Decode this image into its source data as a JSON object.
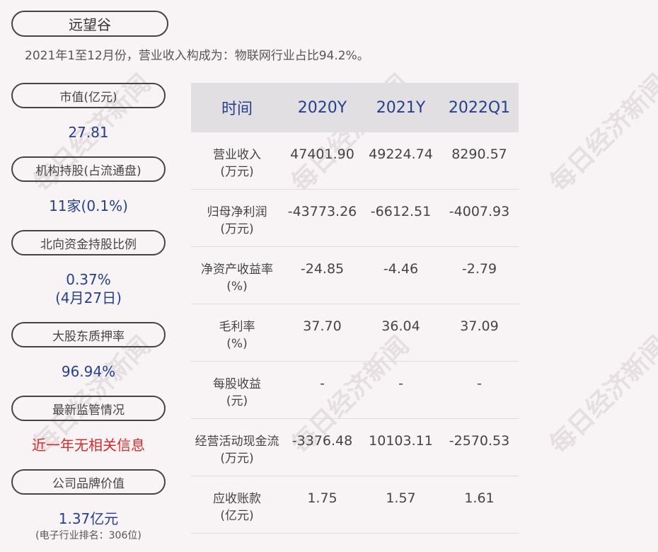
{
  "company": "远望谷",
  "subtitle": "2021年1至12月份，营业收入构成为：物联网行业占比94.2%。",
  "left": {
    "market_cap_label": "市值(亿元)",
    "market_cap_value": "27.81",
    "institution_label": "机构持股(占流通盘)",
    "institution_value": "11家(0.1%)",
    "northbound_label": "北向资金持股比例",
    "northbound_value": "0.37%",
    "northbound_date": "(4月27日)",
    "pledge_label": "大股东质押率",
    "pledge_value": "96.94%",
    "regulation_label": "最新监管情况",
    "regulation_value": "近一年无相关信息",
    "brand_label": "公司品牌价值",
    "brand_value": "1.37亿元",
    "brand_note": "(电子行业排名：306位)"
  },
  "table": {
    "headers": [
      "时间",
      "2020Y",
      "2021Y",
      "2022Q1"
    ],
    "rows": [
      {
        "label1": "营业收入",
        "label2": "(万元)",
        "v": [
          "47401.90",
          "49224.74",
          "8290.57"
        ]
      },
      {
        "label1": "归母净利润",
        "label2": "(万元)",
        "v": [
          "-43773.26",
          "-6612.51",
          "-4007.93"
        ]
      },
      {
        "label1": "净资产收益率",
        "label2": "(%)",
        "v": [
          "-24.85",
          "-4.46",
          "-2.79"
        ]
      },
      {
        "label1": "毛利率",
        "label2": "(%)",
        "v": [
          "37.70",
          "36.04",
          "37.09"
        ]
      },
      {
        "label1": "每股收益",
        "label2": "(元)",
        "v": [
          "-",
          "-",
          "-"
        ]
      },
      {
        "label1": "经营活动现金流",
        "label2": "(万元)",
        "v": [
          "-3376.48",
          "10103.11",
          "-2570.53"
        ]
      },
      {
        "label1": "应收账款",
        "label2": "(亿元)",
        "v": [
          "1.75",
          "1.57",
          "1.61"
        ]
      }
    ]
  },
  "watermark": "每日经济新闻"
}
